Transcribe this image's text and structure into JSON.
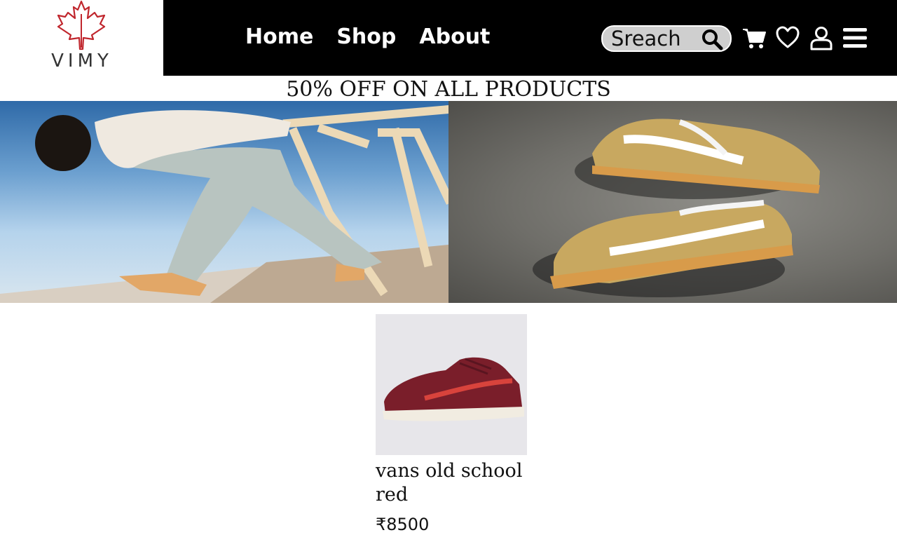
{
  "brand": {
    "name": "VIMY",
    "accent_color": "#c0262d"
  },
  "nav": {
    "items": [
      {
        "label": "Home"
      },
      {
        "label": "Shop"
      },
      {
        "label": "About"
      }
    ]
  },
  "search": {
    "placeholder": "Sreach",
    "icon": "search-icon"
  },
  "header_icons": [
    "cart-icon",
    "heart-icon",
    "user-icon",
    "menu-icon"
  ],
  "promo": {
    "text": "50% OFF ON ALL PRODUCTS"
  },
  "hero": {
    "images": [
      "skater-leaning-on-railing",
      "pair-of-tan-sneakers-on-concrete"
    ]
  },
  "products": [
    {
      "name": "vans old school red",
      "price": "₹8500"
    }
  ]
}
